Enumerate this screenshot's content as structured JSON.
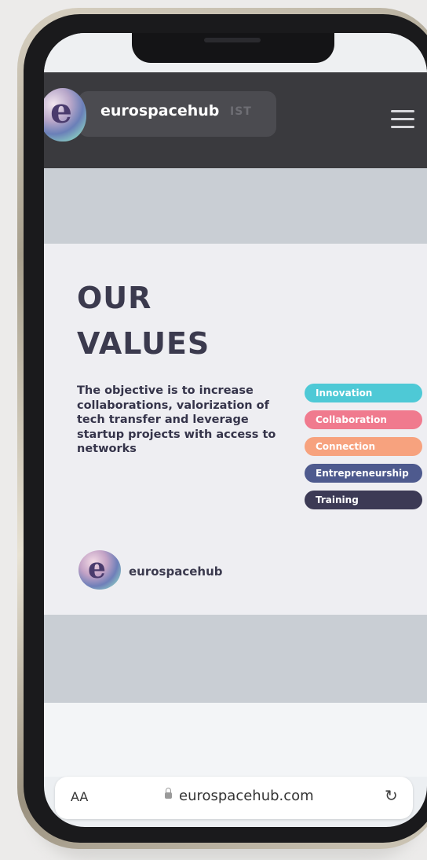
{
  "header": {
    "brand_name": "eurospacehub",
    "brand_ghost_suffix": "IST",
    "logo_glyph": "e",
    "menu_icon": "hamburger-icon"
  },
  "hero": {
    "title_line1": "OUR",
    "title_line2": "VALUES",
    "objective": "The objective is to increase collaborations, valorization of tech transfer and leverage startup projects with access to networks",
    "tags": [
      {
        "label": "Innovation",
        "color": "#4ec9d6"
      },
      {
        "label": "Collaboration",
        "color": "#f07a8e"
      },
      {
        "label": "Connection",
        "color": "#f7a27e"
      },
      {
        "label": "Entrepreneurship",
        "color": "#4e5a8e"
      },
      {
        "label": "Training",
        "color": "#3c3a55"
      }
    ],
    "footer_brand": "eurospacehub",
    "footer_logo_glyph": "e"
  },
  "browser": {
    "text_size_label": "AA",
    "url": "eurospacehub.com",
    "lock_icon": "lock-icon",
    "reload_icon": "reload-icon",
    "reload_glyph": "↻"
  }
}
